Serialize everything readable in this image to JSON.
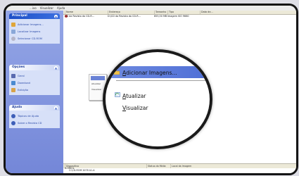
{
  "menubar": {
    "items": [
      "...ivo",
      "Visualizar",
      "Ajuda"
    ]
  },
  "sidebar": {
    "principal": {
      "title": "Principal",
      "items": [
        "Adicionar Imagens...",
        "Localizar Imagens",
        "Selecionar CD-ROM"
      ]
    },
    "opcoes": {
      "title": "Opções",
      "items": [
        "Geral",
        "Download",
        "Exibição"
      ]
    },
    "ajuda": {
      "title": "Ajuda",
      "items": [
        "Tópicos de Ajuda",
        "Sobre o Revista CD"
      ]
    }
  },
  "columns": [
    "Nome",
    "Endereço",
    "Tamanho",
    "Tipo",
    "Data de..."
  ],
  "row": {
    "name": "CD da Revista do CD-R...",
    "address": "D:\\CD da Revista do CD-R...",
    "size": "655,50 MB",
    "type": "Imagem ISO 9660"
  },
  "context_menu": {
    "items": [
      {
        "label": "Adicionar Imagens...",
        "mnemonic": "A",
        "rest": "dicionar Imagens..."
      },
      {
        "label": "Atualizar",
        "mnemonic": "A",
        "rest": "tualizar"
      },
      {
        "label": "Visualizar",
        "mnemonic": "V",
        "rest": "isualizar"
      }
    ]
  },
  "statusbar": {
    "cols": [
      "Dispositivo",
      "Status da Mídia",
      "Local da Imagem"
    ]
  },
  "tree": {
    "root": "ERIOL",
    "child": "C:\\CD-ROM 2078  A1-A"
  },
  "colors": {
    "accent": "#3b6fe0",
    "sidebar_bg": "#8a9de2",
    "highlight": "#5f7dd8"
  }
}
